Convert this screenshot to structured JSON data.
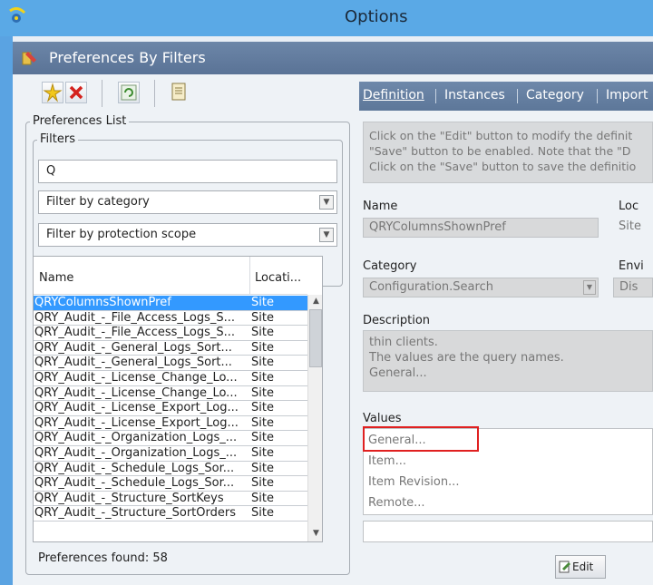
{
  "window": {
    "title": "Options"
  },
  "panel": {
    "title": "Preferences By Filters"
  },
  "left": {
    "preferences_list_label": "Preferences List",
    "filters_label": "Filters",
    "filter_text": "Q",
    "category_filter": "Filter by category",
    "scope_filter": "Filter by protection scope",
    "columns": [
      "Name",
      "Locati..."
    ],
    "rows": [
      [
        "QRYColumnsShownPref",
        "Site"
      ],
      [
        "QRY_Audit_-_File_Access_Logs_S...",
        "Site"
      ],
      [
        "QRY_Audit_-_File_Access_Logs_S...",
        "Site"
      ],
      [
        "QRY_Audit_-_General_Logs_Sort...",
        "Site"
      ],
      [
        "QRY_Audit_-_General_Logs_Sort...",
        "Site"
      ],
      [
        "QRY_Audit_-_License_Change_Lo...",
        "Site"
      ],
      [
        "QRY_Audit_-_License_Change_Lo...",
        "Site"
      ],
      [
        "QRY_Audit_-_License_Export_Log...",
        "Site"
      ],
      [
        "QRY_Audit_-_License_Export_Log...",
        "Site"
      ],
      [
        "QRY_Audit_-_Organization_Logs_...",
        "Site"
      ],
      [
        "QRY_Audit_-_Organization_Logs_...",
        "Site"
      ],
      [
        "QRY_Audit_-_Schedule_Logs_Sor...",
        "Site"
      ],
      [
        "QRY_Audit_-_Schedule_Logs_Sor...",
        "Site"
      ],
      [
        "QRY_Audit_-_Structure_SortKeys",
        "Site"
      ],
      [
        "QRY_Audit_-_Structure_SortOrders",
        "Site"
      ]
    ],
    "found": "Preferences found: 58"
  },
  "right": {
    "tabs": [
      "Definition",
      "Instances",
      "Category",
      "Import"
    ],
    "info_lines": [
      "Click on the \"Edit\" button to modify the definit",
      "\"Save\" button to be enabled. Note that the \"D",
      "Click on the \"Save\" button to save the definitio"
    ],
    "name_label": "Name",
    "name_value": "QRYColumnsShownPref",
    "location_label": "Loc",
    "location_value": "Site",
    "category_label": "Category",
    "category_value": "Configuration.Search",
    "environment_label": "Envi",
    "environment_value": "Dis",
    "description_label": "Description",
    "description_lines": [
      "thin clients.",
      "The values are the query names.",
      "General..."
    ],
    "values_label": "Values",
    "values": [
      "General...",
      "Item...",
      "Item Revision...",
      "Remote..."
    ],
    "edit_button": "Edit"
  },
  "colors": {
    "selection": "#3399ff",
    "highlight": "#e02020",
    "title_bar": "#5aa9e6"
  }
}
